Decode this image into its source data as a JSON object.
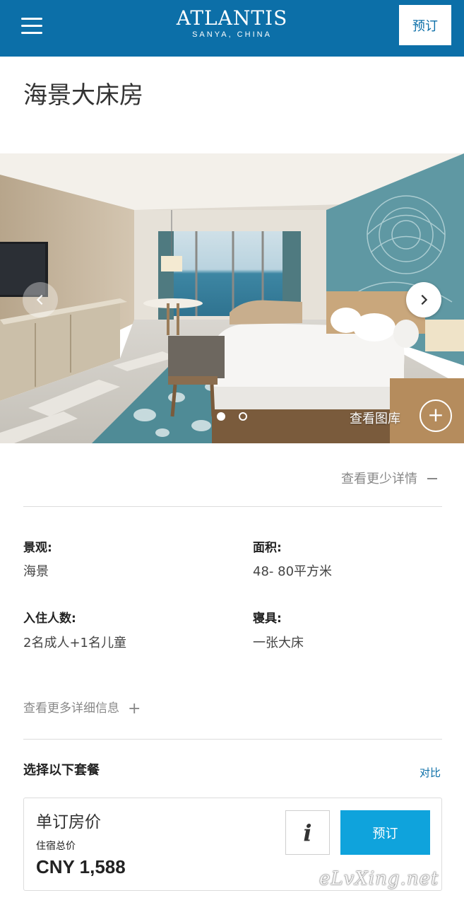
{
  "header": {
    "logo_main": "ATLANTIS",
    "logo_sub": "SANYA, CHINA",
    "book_label": "预订",
    "menu_icon": "hamburger-menu-icon",
    "bg_color": "#0c6fa8"
  },
  "room": {
    "title": "海景大床房"
  },
  "gallery": {
    "view_gallery_label": "查看图库",
    "prev_icon": "chevron-left-icon",
    "next_icon": "chevron-right-icon",
    "plus_icon": "plus-circle-icon",
    "active_slide": 1,
    "slide_count": 2
  },
  "details": {
    "less_label": "查看更少详情",
    "attributes": [
      {
        "label": "景观:",
        "value": "海景"
      },
      {
        "label": "面积:",
        "value": "48- 80平方米"
      },
      {
        "label": "入住人数:",
        "value": "2名成人+1名儿童"
      },
      {
        "label": "寝具:",
        "value": "一张大床"
      }
    ],
    "more_label": "查看更多详细信息"
  },
  "packages": {
    "title": "选择以下套餐",
    "compare_label": "对比",
    "rate": {
      "name": "单订房价",
      "total_label": "住宿总价",
      "price": "CNY 1,588",
      "info_label": "i",
      "book_label": "预订",
      "book_color": "#0fa3dc"
    }
  },
  "watermark": "eLvXing.net"
}
